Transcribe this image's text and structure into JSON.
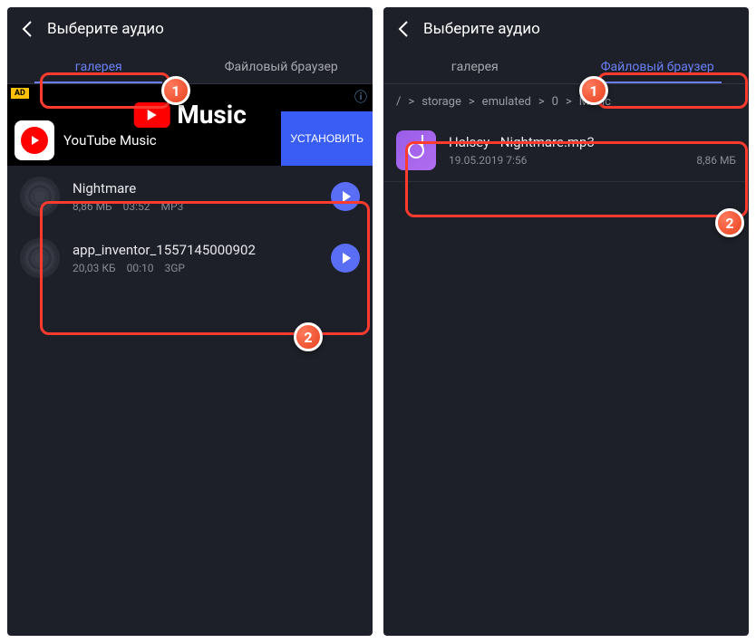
{
  "left": {
    "title": "Выберите аудио",
    "tabs": {
      "gallery": "галерея",
      "browser": "Файловый браузер"
    },
    "ad": {
      "label": "AD",
      "bg_text": "Music",
      "title": "YouTube Music",
      "install": "УСТАНОВИТЬ"
    },
    "items": [
      {
        "name": "Nightmare",
        "size": "8,86 МБ",
        "duration": "03:52",
        "format": "MP3"
      },
      {
        "name": "app_inventor_1557145000902",
        "size": "20,03 КБ",
        "duration": "00:10",
        "format": "3GP"
      }
    ],
    "badges": {
      "one": "1",
      "two": "2"
    }
  },
  "right": {
    "title": "Выберите аудио",
    "tabs": {
      "gallery": "галерея",
      "browser": "Файловый браузер"
    },
    "breadcrumb": [
      "/",
      ">",
      "storage",
      ">",
      "emulated",
      ">",
      "0",
      ">",
      "Music"
    ],
    "files": [
      {
        "name": "Halsey - Nightmare.mp3",
        "date": "19.05.2019 7:56",
        "size": "8,86 МБ"
      }
    ],
    "badges": {
      "one": "1",
      "two": "2"
    }
  }
}
